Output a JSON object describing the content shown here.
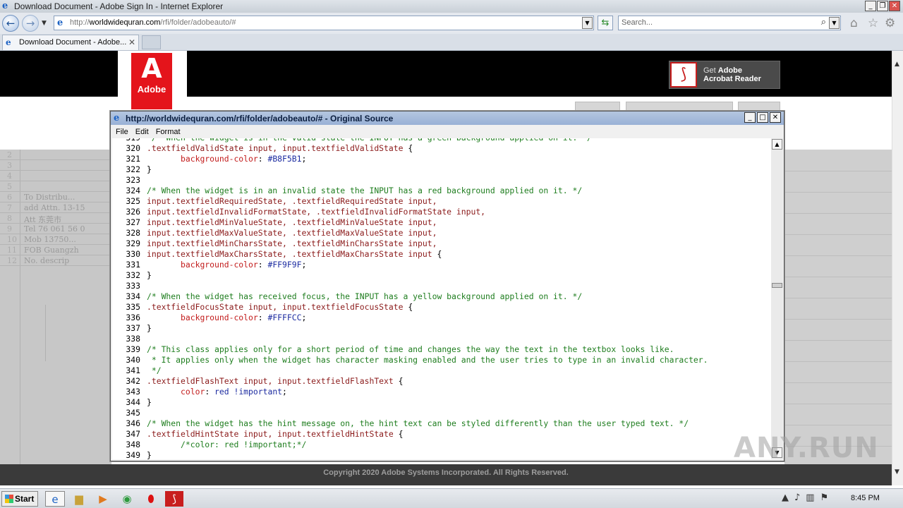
{
  "browser": {
    "window_title": "Download Document - Adobe Sign In - Internet Explorer",
    "url_prefix": "http://",
    "url_domain": "worldwidequran.com",
    "url_path": "/rfi/folder/adobeauto/#",
    "search_placeholder": "Search...",
    "tab_label": "Download Document - Adobe...",
    "window_buttons": [
      "_",
      "❐",
      "✕"
    ]
  },
  "page": {
    "logo_letter": "A",
    "logo_text": "Adobe",
    "reader_line1_prefix": "Get ",
    "reader_line1_bold": "Adobe",
    "reader_line2": "Acrobat Reader",
    "copyright": "Copyright 2020 Adobe Systems Incorporated. All Rights Reserved."
  },
  "source_window": {
    "title": "http://worldwidequran.com/rfi/folder/adobeauto/# - Original Source",
    "menu": [
      "File",
      "Edit",
      "Format"
    ],
    "lines": [
      {
        "n": "319",
        "segs": [
          {
            "c": "cm",
            "t": " /* When the widget is in the valid state the INPUT has a green background applied on it. */"
          }
        ]
      },
      {
        "n": "320",
        "segs": [
          {
            "c": "sel",
            "t": ".textfieldValidState input, input.textfieldValidState "
          },
          {
            "c": "pn",
            "t": "{"
          }
        ]
      },
      {
        "n": "321",
        "segs": [
          {
            "c": "pn",
            "t": "       "
          },
          {
            "c": "prop",
            "t": "background-color"
          },
          {
            "c": "pn",
            "t": ": "
          },
          {
            "c": "val",
            "t": "#B8F5B1"
          },
          {
            "c": "pn",
            "t": ";"
          }
        ]
      },
      {
        "n": "322",
        "segs": [
          {
            "c": "pn",
            "t": "}"
          }
        ]
      },
      {
        "n": "323",
        "segs": []
      },
      {
        "n": "324",
        "segs": [
          {
            "c": "cm",
            "t": "/* When the widget is in an invalid state the INPUT has a red background applied on it. */"
          }
        ]
      },
      {
        "n": "325",
        "segs": [
          {
            "c": "sel",
            "t": "input.textfieldRequiredState, .textfieldRequiredState input,"
          }
        ]
      },
      {
        "n": "326",
        "segs": [
          {
            "c": "sel",
            "t": "input.textfieldInvalidFormatState, .textfieldInvalidFormatState input,"
          }
        ]
      },
      {
        "n": "327",
        "segs": [
          {
            "c": "sel",
            "t": "input.textfieldMinValueState, .textfieldMinValueState input,"
          }
        ]
      },
      {
        "n": "328",
        "segs": [
          {
            "c": "sel",
            "t": "input.textfieldMaxValueState, .textfieldMaxValueState input,"
          }
        ]
      },
      {
        "n": "329",
        "segs": [
          {
            "c": "sel",
            "t": "input.textfieldMinCharsState, .textfieldMinCharsState input,"
          }
        ]
      },
      {
        "n": "330",
        "segs": [
          {
            "c": "sel",
            "t": "input.textfieldMaxCharsState, .textfieldMaxCharsState input "
          },
          {
            "c": "pn",
            "t": "{"
          }
        ]
      },
      {
        "n": "331",
        "segs": [
          {
            "c": "pn",
            "t": "       "
          },
          {
            "c": "prop",
            "t": "background-color"
          },
          {
            "c": "pn",
            "t": ": "
          },
          {
            "c": "val",
            "t": "#FF9F9F"
          },
          {
            "c": "pn",
            "t": ";"
          }
        ]
      },
      {
        "n": "332",
        "segs": [
          {
            "c": "pn",
            "t": "}"
          }
        ]
      },
      {
        "n": "333",
        "segs": []
      },
      {
        "n": "334",
        "segs": [
          {
            "c": "cm",
            "t": "/* When the widget has received focus, the INPUT has a yellow background applied on it. */"
          }
        ]
      },
      {
        "n": "335",
        "segs": [
          {
            "c": "sel",
            "t": ".textfieldFocusState input, input.textfieldFocusState "
          },
          {
            "c": "pn",
            "t": "{"
          }
        ]
      },
      {
        "n": "336",
        "segs": [
          {
            "c": "pn",
            "t": "       "
          },
          {
            "c": "prop",
            "t": "background-color"
          },
          {
            "c": "pn",
            "t": ": "
          },
          {
            "c": "val",
            "t": "#FFFFCC"
          },
          {
            "c": "pn",
            "t": ";"
          }
        ]
      },
      {
        "n": "337",
        "segs": [
          {
            "c": "pn",
            "t": "}"
          }
        ]
      },
      {
        "n": "338",
        "segs": []
      },
      {
        "n": "339",
        "segs": [
          {
            "c": "cm",
            "t": "/* This class applies only for a short period of time and changes the way the text in the textbox looks like."
          }
        ]
      },
      {
        "n": "340",
        "segs": [
          {
            "c": "cm",
            "t": " * It applies only when the widget has character masking enabled and the user tries to type in an invalid character."
          }
        ]
      },
      {
        "n": "341",
        "segs": [
          {
            "c": "cm",
            "t": " */"
          }
        ]
      },
      {
        "n": "342",
        "segs": [
          {
            "c": "sel",
            "t": ".textfieldFlashText input, input.textfieldFlashText "
          },
          {
            "c": "pn",
            "t": "{"
          }
        ]
      },
      {
        "n": "343",
        "segs": [
          {
            "c": "pn",
            "t": "       "
          },
          {
            "c": "prop",
            "t": "color"
          },
          {
            "c": "pn",
            "t": ": "
          },
          {
            "c": "val",
            "t": "red !important"
          },
          {
            "c": "pn",
            "t": ";"
          }
        ]
      },
      {
        "n": "344",
        "segs": [
          {
            "c": "pn",
            "t": "}"
          }
        ]
      },
      {
        "n": "345",
        "segs": []
      },
      {
        "n": "346",
        "segs": [
          {
            "c": "cm",
            "t": "/* When the widget has the hint message on, the hint text can be styled differently than the user typed text. */"
          }
        ]
      },
      {
        "n": "347",
        "segs": [
          {
            "c": "sel",
            "t": ".textfieldHintState input, input.textfieldHintState "
          },
          {
            "c": "pn",
            "t": "{"
          }
        ]
      },
      {
        "n": "348",
        "segs": [
          {
            "c": "pn",
            "t": "       "
          },
          {
            "c": "cm",
            "t": "/*color: red !important;*/"
          }
        ]
      },
      {
        "n": "349",
        "segs": [
          {
            "c": "pn",
            "t": "}"
          }
        ]
      }
    ]
  },
  "background_sheet": {
    "rows": [
      {
        "n": "2",
        "t": ""
      },
      {
        "n": "3",
        "t": ""
      },
      {
        "n": "4",
        "t": ""
      },
      {
        "n": "5",
        "t": ""
      },
      {
        "n": "6",
        "t": "To   Distribu..."
      },
      {
        "n": "7",
        "t": "add  Attn. 13-15"
      },
      {
        "n": "8",
        "t": "Att  东莞市"
      },
      {
        "n": "9",
        "t": "Tel  76 061 56 0"
      },
      {
        "n": "10",
        "t": "Mob  13750..."
      },
      {
        "n": "11",
        "t": "FOB  Guangzh"
      },
      {
        "n": "12",
        "t": "No.     descrip"
      }
    ]
  },
  "watermark": "ANY.RUN",
  "taskbar": {
    "start_label": "Start",
    "clock": "8:45 PM"
  }
}
